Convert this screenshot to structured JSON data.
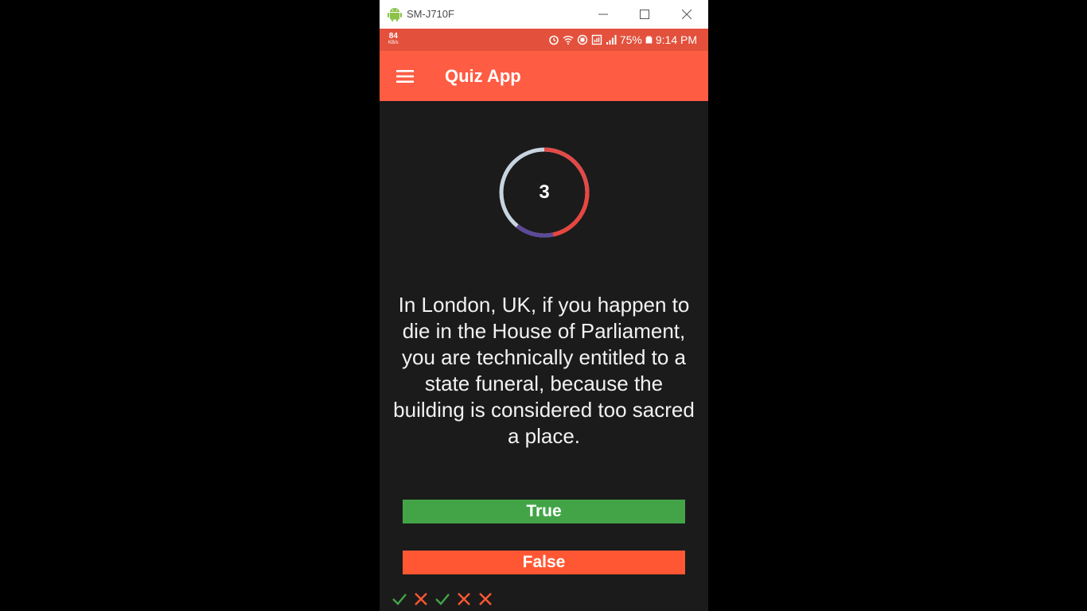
{
  "window": {
    "title": "SM-J710F",
    "icon": "android-icon",
    "controls": [
      "minimize-icon",
      "maximize-icon",
      "close-icon"
    ]
  },
  "status_bar": {
    "net_speed": "84",
    "net_speed_unit": "KB/s",
    "icons": [
      "alarm-icon",
      "wifi-icon",
      "sync-icon",
      "screenshot-icon",
      "signal-icon",
      "battery-icon"
    ],
    "battery": "75%",
    "time": "9:14 PM"
  },
  "app_bar": {
    "menu_icon": "hamburger-menu-icon",
    "title": "Quiz App"
  },
  "timer": {
    "count": "3"
  },
  "question": {
    "text": "In London, UK, if you happen to die in the House of Parliament, you are technically entitled to a state funeral, because the building is considered too sacred a place."
  },
  "answers": {
    "true_label": "True",
    "false_label": "False"
  },
  "score_history": [
    "correct",
    "wrong",
    "correct",
    "wrong",
    "wrong"
  ],
  "colors": {
    "status_bar": "#e3513c",
    "app_bar": "#ff5c44",
    "background": "#1b1b1b",
    "true_button": "#43a447",
    "false_button": "#ff5733",
    "correct_mark": "#43a447",
    "wrong_mark": "#ff5733"
  }
}
